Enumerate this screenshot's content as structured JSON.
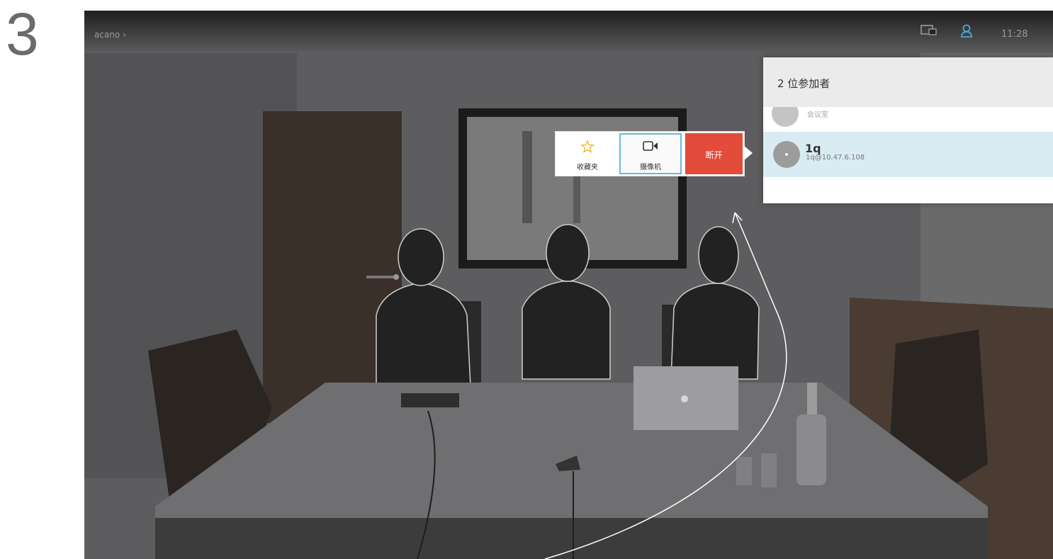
{
  "step_number": "3",
  "topbar": {
    "call_name": "acano ›",
    "clock": "11:28"
  },
  "participants_panel": {
    "title": "2 位参加者",
    "top_row_label": "会议室",
    "selected_participant": {
      "name": "1q",
      "address": "1q@10.47.6.108"
    }
  },
  "action_popup": {
    "favorite_label": "收藏夹",
    "camera_label": "摄像机",
    "disconnect_label": "断开"
  },
  "colors": {
    "disconnect": "#e34c3a",
    "selected_row": "#d9ecf4",
    "focus_border": "#6fb6d9",
    "star": "#f2b630"
  },
  "icons": [
    "star-icon",
    "camera-icon",
    "screen-share-icon",
    "participants-icon"
  ]
}
